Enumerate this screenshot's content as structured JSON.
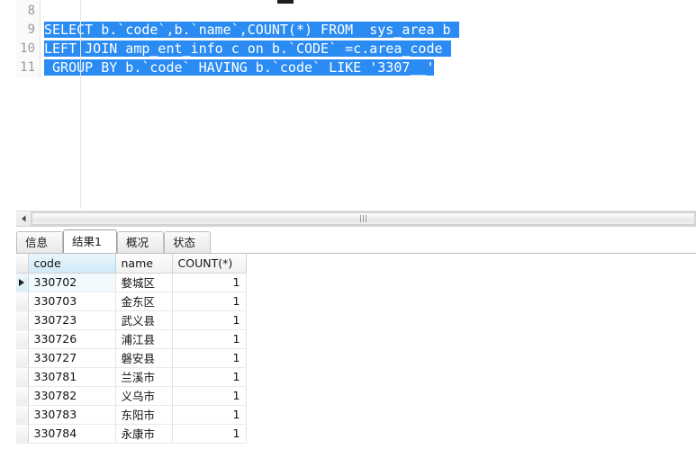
{
  "editor": {
    "name": "sql-editor",
    "selection_color": "#2a8bf2",
    "selection_text_color": "#ffffff",
    "lines": [
      {
        "number": "8",
        "text": "",
        "selected": ""
      },
      {
        "number": "9",
        "text": "",
        "selected": "SELECT b.`code`,b.`name`,COUNT(*) FROM  sys_area b "
      },
      {
        "number": "10",
        "text": "",
        "selected": "LEFT JOIN amp_ent_info c on b.`CODE` =c.area_code "
      },
      {
        "number": "11",
        "text": "",
        "selected": " GROUP BY b.`code` HAVING b.`code` LIKE '3307__'"
      }
    ]
  },
  "scrollbar": {
    "left_arrow_icon": "triangle-left-icon",
    "grip_icon": "grip-lines-icon"
  },
  "tabs": [
    {
      "label": "信息",
      "name": "tab-info",
      "active": false
    },
    {
      "label": "结果1",
      "name": "tab-result1",
      "active": true
    },
    {
      "label": "概况",
      "name": "tab-profile",
      "active": false
    },
    {
      "label": "状态",
      "name": "tab-status",
      "active": false
    }
  ],
  "result_grid": {
    "columns": [
      {
        "label": "code",
        "name": "column-header-code",
        "selected": true,
        "align": "left"
      },
      {
        "label": "name",
        "name": "column-header-name",
        "selected": false,
        "align": "left"
      },
      {
        "label": "COUNT(*)",
        "name": "column-header-count",
        "selected": false,
        "align": "right"
      }
    ],
    "current_row_index": 0,
    "row_marker_icon": "triangle-right-icon",
    "rows": [
      {
        "code": "330702",
        "name": "婺城区",
        "count": "1"
      },
      {
        "code": "330703",
        "name": "金东区",
        "count": "1"
      },
      {
        "code": "330723",
        "name": "武义县",
        "count": "1"
      },
      {
        "code": "330726",
        "name": "浦江县",
        "count": "1"
      },
      {
        "code": "330727",
        "name": "磐安县",
        "count": "1"
      },
      {
        "code": "330781",
        "name": "兰溪市",
        "count": "1"
      },
      {
        "code": "330782",
        "name": "义乌市",
        "count": "1"
      },
      {
        "code": "330783",
        "name": "东阳市",
        "count": "1"
      },
      {
        "code": "330784",
        "name": "永康市",
        "count": "1"
      }
    ]
  }
}
